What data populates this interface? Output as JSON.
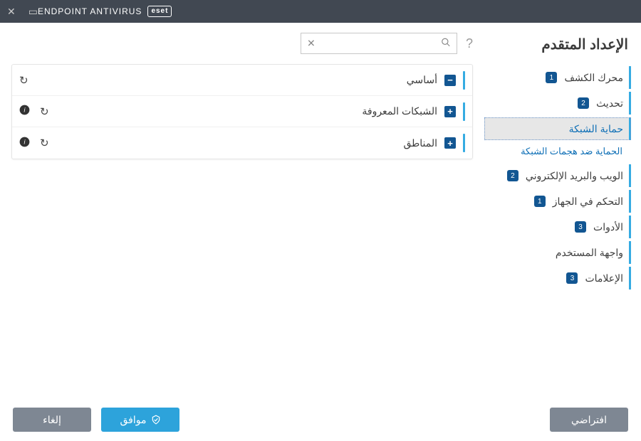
{
  "titlebar": {
    "brand_logo": "eset",
    "brand_text": "ENDPOINT ANTIVIRUS"
  },
  "heading": "الإعداد المتقدم",
  "nav": [
    {
      "label": "محرك الكشف",
      "badge": "1"
    },
    {
      "label": "تحديث",
      "badge": "2"
    },
    {
      "label": "حماية الشبكة",
      "badge": "",
      "selected": true,
      "sub": "الحماية ضد هجمات الشبكة"
    },
    {
      "label": "الويب والبريد الإلكتروني",
      "badge": "2"
    },
    {
      "label": "التحكم في الجهاز",
      "badge": "1"
    },
    {
      "label": "الأدوات",
      "badge": "3"
    },
    {
      "label": "واجهة المستخدم",
      "badge": ""
    },
    {
      "label": "الإعلامات",
      "badge": "3"
    }
  ],
  "search": {
    "placeholder": ""
  },
  "sections": [
    {
      "label": "أساسي",
      "expanded": true,
      "info": false
    },
    {
      "label": "الشبكات المعروفة",
      "expanded": false,
      "info": true
    },
    {
      "label": "المناطق",
      "expanded": false,
      "info": true
    }
  ],
  "footer": {
    "default": "افتراضي",
    "ok": "موافق",
    "cancel": "إلغاء"
  }
}
